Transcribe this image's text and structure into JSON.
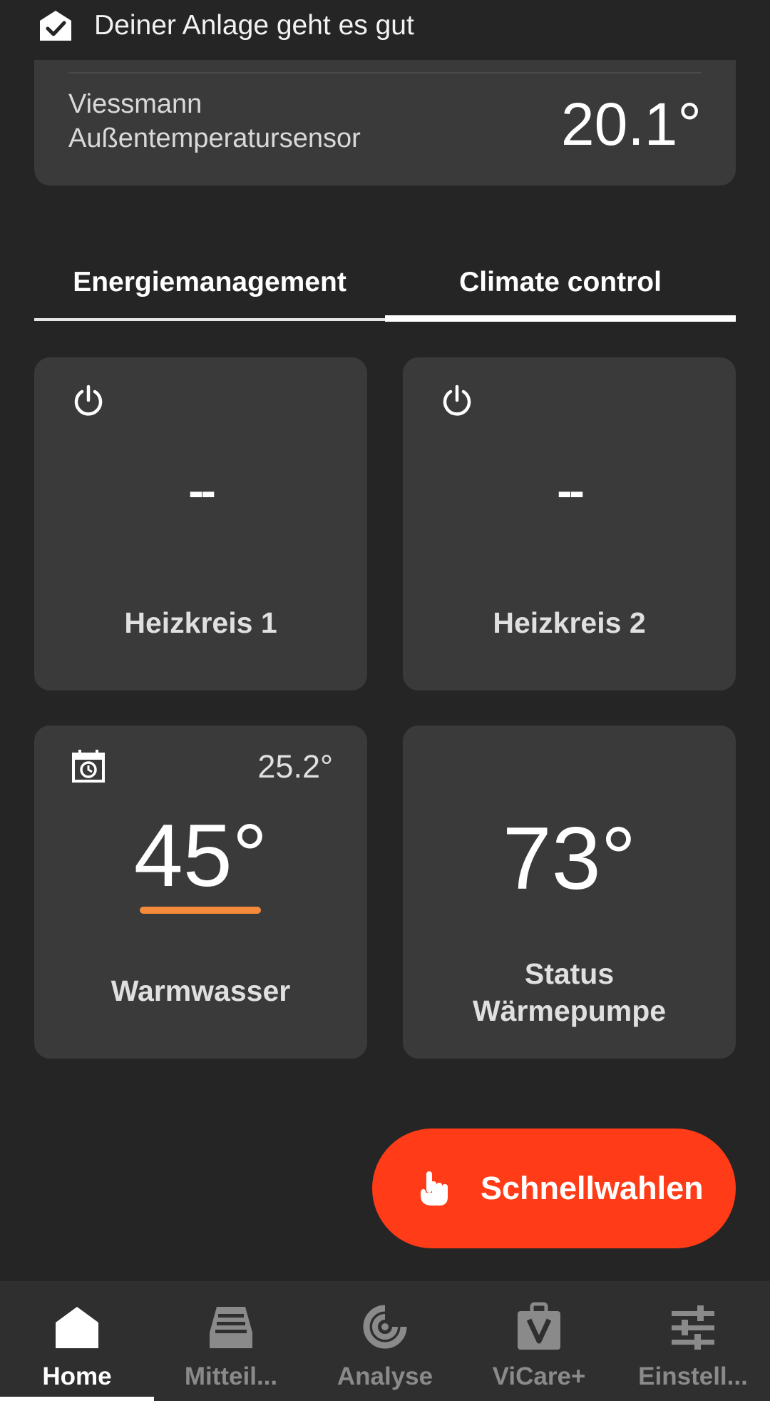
{
  "status_banner": {
    "text": "Deiner Anlage geht es gut"
  },
  "sensor": {
    "name": "Viessmann Außentemperatursensor",
    "value": "20.1°"
  },
  "tabs": [
    {
      "label": "Energiemanagement",
      "selected": false
    },
    {
      "label": "Climate control",
      "selected": true
    }
  ],
  "tiles": {
    "heizkreis1": {
      "value": "--",
      "label": "Heizkreis 1",
      "icon": "power-icon"
    },
    "heizkreis2": {
      "value": "--",
      "label": "Heizkreis 2",
      "icon": "power-icon"
    },
    "warmwasser": {
      "value": "45°",
      "current_temp": "25.2°",
      "label": "Warmwasser",
      "icon": "calendar-clock-icon",
      "accent": "#f58a3a"
    },
    "waermepumpe": {
      "value": "73°",
      "label_line1": "Status",
      "label_line2": "Wärmepumpe"
    }
  },
  "fab": {
    "label": "Schnellwahlen",
    "icon": "hand-pointer-icon",
    "color": "#ff3c17"
  },
  "bottom_nav": [
    {
      "label": "Home",
      "icon": "home-icon",
      "active": true
    },
    {
      "label": "Mitteil...",
      "icon": "inbox-icon",
      "active": false
    },
    {
      "label": "Analyse",
      "icon": "analysis-icon",
      "active": false
    },
    {
      "label": "ViCare+",
      "icon": "vicare-bag-icon",
      "active": false
    },
    {
      "label": "Einstell...",
      "icon": "sliders-icon",
      "active": false
    }
  ]
}
